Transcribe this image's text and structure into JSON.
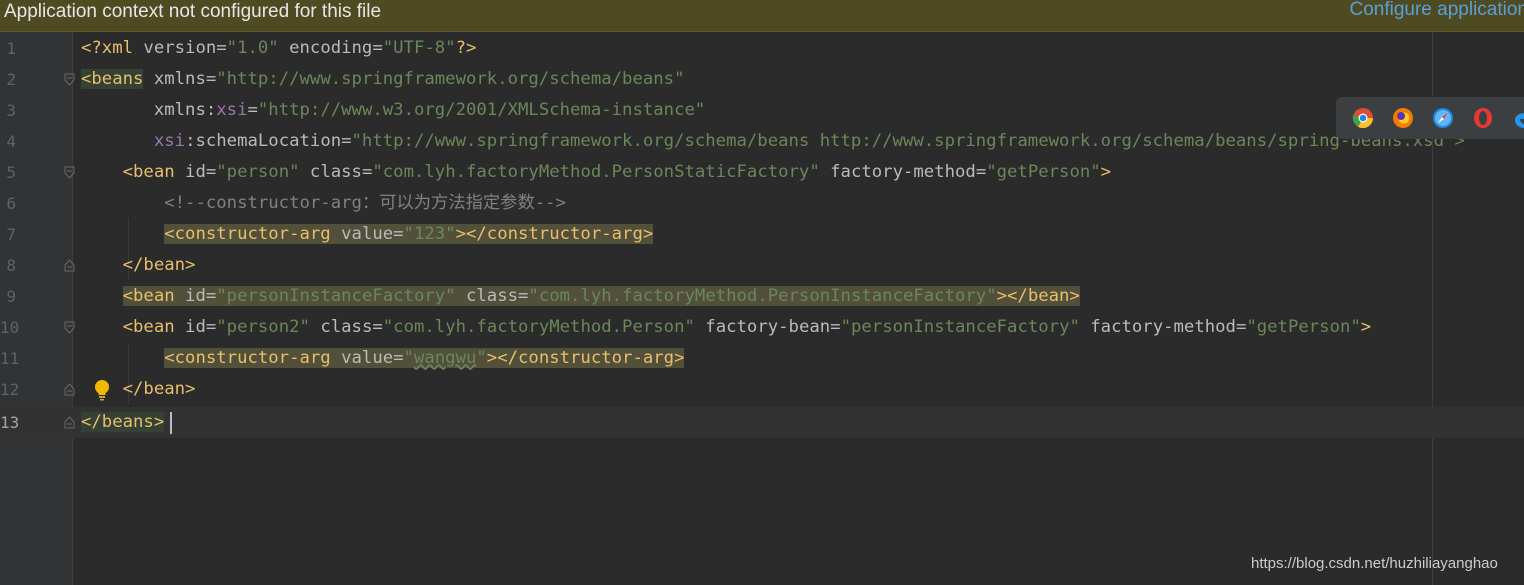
{
  "banner": {
    "message": "Application context not configured for this file",
    "link": "Configure application"
  },
  "lines": [
    {
      "n": "1"
    },
    {
      "n": "2"
    },
    {
      "n": "3"
    },
    {
      "n": "4"
    },
    {
      "n": "5"
    },
    {
      "n": "6"
    },
    {
      "n": "7"
    },
    {
      "n": "8"
    },
    {
      "n": "9"
    },
    {
      "n": "10"
    },
    {
      "n": "11"
    },
    {
      "n": "12"
    },
    {
      "n": "13"
    }
  ],
  "code": {
    "l1": {
      "p1": "<?xml",
      "a1": " version=",
      "v1": "\"1.0\"",
      "a2": " encoding=",
      "v2": "\"UTF-8\"",
      "p2": "?>"
    },
    "l2": {
      "tag": "<beans",
      "a1": " xmlns=",
      "v1": "\"http://www.springframework.org/schema/beans\""
    },
    "l3": {
      "indent": "       ",
      "a1": "xmlns:",
      "ns": "xsi",
      "a2": "=",
      "v1": "\"http://www.w3.org/2001/XMLSchema-instance\""
    },
    "l4": {
      "indent": "       ",
      "ns": "xsi",
      "a1": ":schemaLocation=",
      "v1": "\"http://www.springframework.org/schema/beans http://www.springframework.org/schema/beans/spring-beans.xsd\">"
    },
    "l5": {
      "indent": "    ",
      "tag": "<bean",
      "a1": " id=",
      "v1": "\"person\"",
      "a2": " class=",
      "v2": "\"com.lyh.factoryMethod.PersonStaticFactory\"",
      "a3": " factory-method=",
      "v3": "\"getPerson\"",
      "end": ">"
    },
    "l6": {
      "indent": "        ",
      "comment": "<!--constructor-arg：可以为方法指定参数-->"
    },
    "l7": {
      "indent": "        ",
      "tag": "<constructor-arg",
      "a1": " value=",
      "v1": "\"123\"",
      "end": "></constructor-arg>"
    },
    "l8": {
      "indent": "    ",
      "tag": "</bean>"
    },
    "l9": {
      "indent": "    ",
      "tag": "<bean",
      "a1": " id=",
      "v1": "\"personInstanceFactory\"",
      "a2": " class=",
      "v2": "\"com.lyh.factoryMethod.PersonInstanceFactory\"",
      "end": "></bean>"
    },
    "l10": {
      "indent": "    ",
      "tag": "<bean",
      "a1": " id=",
      "v1": "\"person2\"",
      "a2": " class=",
      "v2": "\"com.lyh.factoryMethod.Person\"",
      "a3": " factory-bean=",
      "v3": "\"personInstanceFactory\"",
      "a4": " factory-method=",
      "v4": "\"getPerson\"",
      "end": ">"
    },
    "l11": {
      "indent": "        ",
      "tag": "<constructor-arg",
      "a1": " value=",
      "q1": "\"",
      "v1": "wangwu",
      "q2": "\"",
      "end": "></constructor-arg>"
    },
    "l12": {
      "indent": "    ",
      "tag": "</bean>"
    },
    "l13": {
      "tag": "</beans>"
    }
  },
  "browsers": [
    {
      "icon": "chrome-icon",
      "color": "#dd4b39"
    },
    {
      "icon": "firefox-icon",
      "color": "#f57c00"
    },
    {
      "icon": "safari-icon",
      "color": "#1e88e5"
    },
    {
      "icon": "opera-icon",
      "color": "#e53935"
    },
    {
      "icon": "edge-icon",
      "color": "#2196f3"
    }
  ],
  "watermark": "https://blog.csdn.net/huzhiliayanghao",
  "colors": {
    "background": "#2b2b2b",
    "banner": "#4e4b23",
    "tag": "#e8bf6a",
    "attribute": "#bababa",
    "value": "#6a8759",
    "namespace": "#9876aa",
    "comment": "#808080",
    "link": "#5a9fd6"
  }
}
